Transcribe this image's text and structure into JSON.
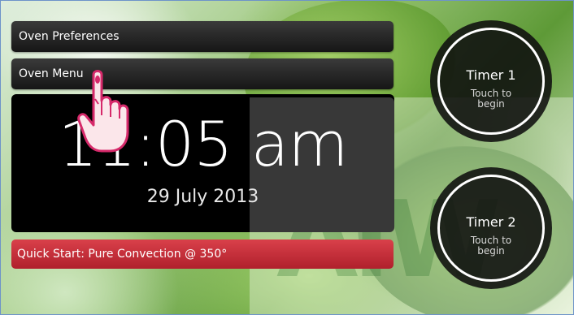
{
  "menu": {
    "preferences_label": "Oven Preferences",
    "oven_menu_label": "Oven Menu"
  },
  "clock": {
    "time": "11:05 am",
    "date": "29 July 2013"
  },
  "quick_start": {
    "label": "Quick Start: Pure Convection @ 350°",
    "color": "#c12a35"
  },
  "timers": [
    {
      "title": "Timer 1",
      "sub_line1": "Touch to",
      "sub_line2": "begin"
    },
    {
      "title": "Timer 2",
      "sub_line1": "Touch to",
      "sub_line2": "begin"
    }
  ],
  "watermark": "AiW",
  "icons": {
    "pointer": "hand-pointer-icon"
  }
}
